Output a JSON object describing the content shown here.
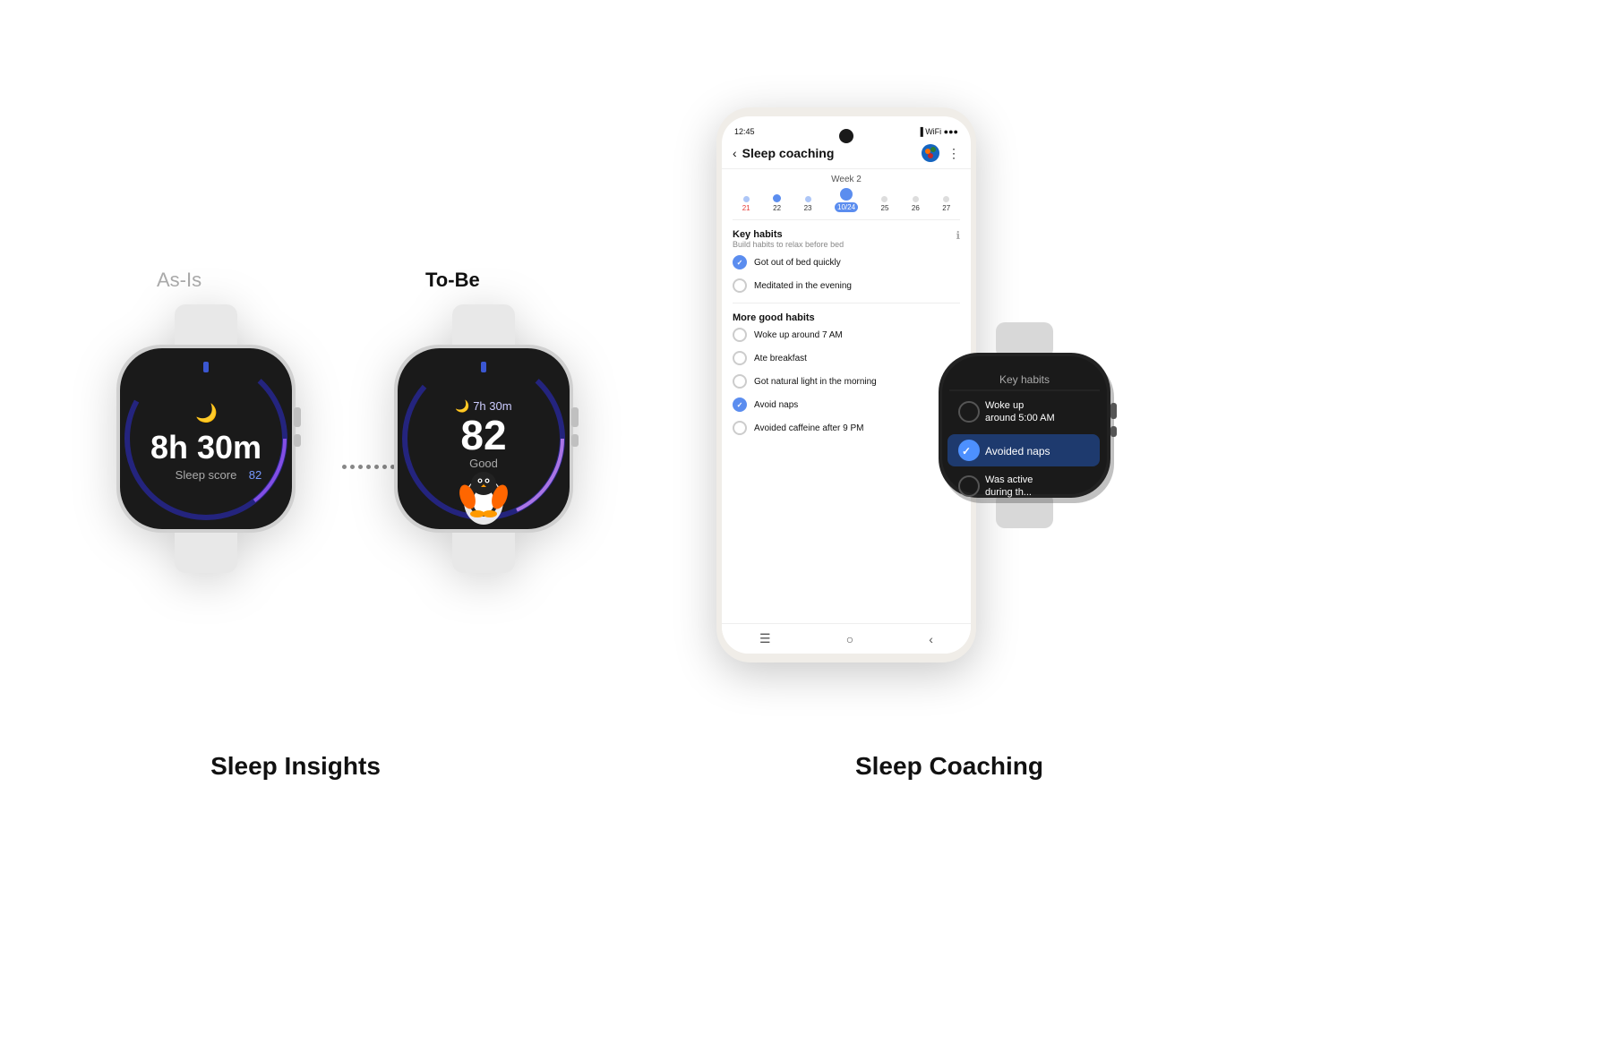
{
  "labels": {
    "as_is": "As-Is",
    "to_be": "To-Be",
    "sleep_insights": "Sleep Insights",
    "sleep_coaching": "Sleep Coaching"
  },
  "watch_left": {
    "time_display": "8h 30m",
    "label": "Sleep score 82"
  },
  "watch_right": {
    "time_display": "7h 30m",
    "score": "82",
    "quality": "Good"
  },
  "phone": {
    "status_time": "12:45",
    "title": "Sleep coaching",
    "week": "Week 2",
    "calendar": [
      {
        "num": "21",
        "dot_size": "small",
        "red": true
      },
      {
        "num": "22",
        "dot_size": "medium",
        "red": false
      },
      {
        "num": "23",
        "dot_size": "small",
        "red": false
      },
      {
        "num": "10/24",
        "dot_size": "large",
        "selected": true,
        "red": false
      },
      {
        "num": "25",
        "dot_size": "small",
        "red": false
      },
      {
        "num": "26",
        "dot_size": "small",
        "red": false
      },
      {
        "num": "27",
        "dot_size": "small",
        "red": false
      }
    ],
    "key_habits": {
      "title": "Key habits",
      "subtitle": "Build habits to relax before bed",
      "items": [
        {
          "text": "Got out of bed quickly",
          "checked": true
        },
        {
          "text": "Meditated in the evening",
          "checked": false
        }
      ]
    },
    "more_habits": {
      "title": "More good habits",
      "items": [
        {
          "text": "Woke up around 7 AM",
          "checked": false
        },
        {
          "text": "Ate breakfast",
          "checked": false
        },
        {
          "text": "Got natural light in the morning",
          "checked": false
        },
        {
          "text": "Avoid naps",
          "checked": true
        },
        {
          "text": "Avoided caffeine after 9 PM",
          "checked": false
        }
      ]
    }
  },
  "watch_overlay": {
    "title": "Key habits",
    "items": [
      {
        "text": "Woke up\naround 5:00 AM",
        "checked": false
      },
      {
        "text": "Avoided naps",
        "checked": true
      },
      {
        "text": "Was active\nduring th...",
        "checked": false
      }
    ]
  }
}
